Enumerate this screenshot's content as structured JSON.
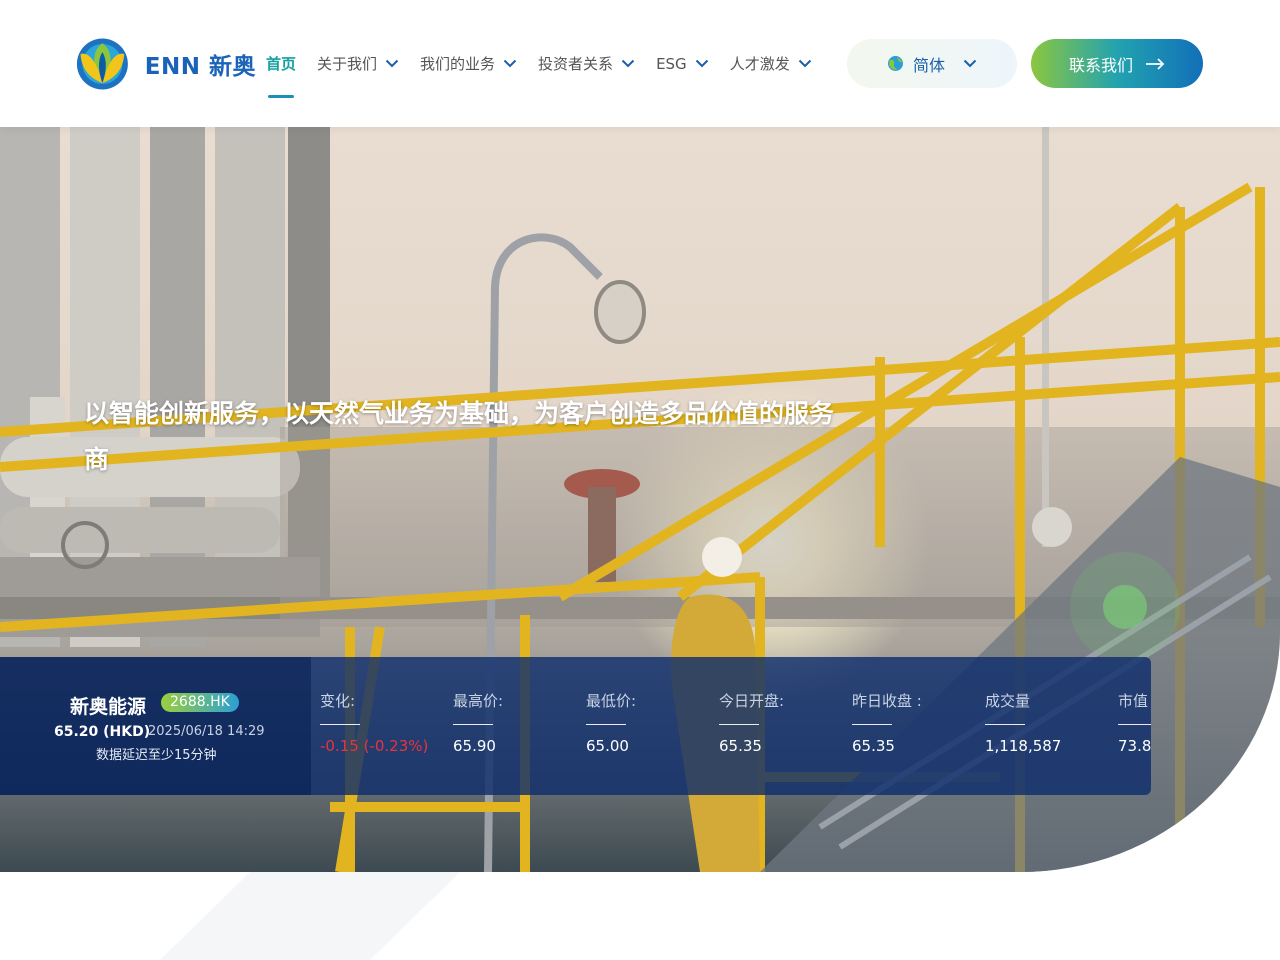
{
  "header": {
    "logo_text": "ENN 新奥",
    "nav": [
      {
        "label": "首页",
        "active": true,
        "dropdown": false
      },
      {
        "label": "关于我们",
        "active": false,
        "dropdown": true
      },
      {
        "label": "我们的业务",
        "active": false,
        "dropdown": true
      },
      {
        "label": "投资者关系",
        "active": false,
        "dropdown": true
      },
      {
        "label": "ESG",
        "active": false,
        "dropdown": true
      },
      {
        "label": "人才激发",
        "active": false,
        "dropdown": true
      }
    ],
    "language": "简体",
    "contact_label": "联系我们"
  },
  "hero": {
    "headline": "以智能创新服务，以天然气业务为基础，为客户创造多品价值的服务商"
  },
  "stock": {
    "name": "新奥能源",
    "ticker": "2688.HK",
    "price": "65.20 (HKD)",
    "datetime": "2025/06/18 14:29",
    "delay_note": "数据延迟至少15分钟",
    "stats": [
      {
        "label": "变化:",
        "value": "-0.15 (-0.23%)",
        "negative": true
      },
      {
        "label": "最高价:",
        "value": "65.90",
        "negative": false
      },
      {
        "label": "最低价:",
        "value": "65.00",
        "negative": false
      },
      {
        "label": "今日开盘:",
        "value": "65.35",
        "negative": false
      },
      {
        "label": "昨日收盘 :",
        "value": "65.35",
        "negative": false
      },
      {
        "label": "成交量",
        "value": "1,118,587",
        "negative": false
      },
      {
        "label": "市值",
        "value": "73.8",
        "negative": false
      }
    ]
  },
  "colors": {
    "brand_blue": "#1a63b8",
    "brand_green": "#8cc63f",
    "nav_active": "#17a0a2",
    "stock_bar": "#0c2c6c",
    "negative": "#e8343c"
  },
  "icons": [
    "enn-logo-icon",
    "chevron-down-icon",
    "globe-icon",
    "arrow-right-icon"
  ]
}
